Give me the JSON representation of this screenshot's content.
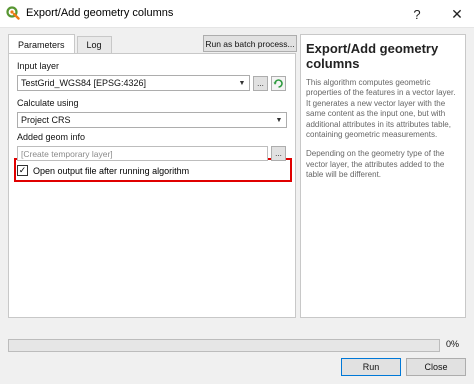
{
  "window": {
    "title": "Export/Add geometry columns",
    "help_glyph": "?",
    "close_glyph": "✕"
  },
  "tabs": [
    {
      "label": "Parameters",
      "active": true
    },
    {
      "label": "Log",
      "active": false
    }
  ],
  "batch_button": "Run as batch process...",
  "params": {
    "input_layer": {
      "label": "Input layer",
      "value": "TestGrid_WGS84 [EPSG:4326]",
      "browse_label": "..."
    },
    "calculate_using": {
      "label": "Calculate using",
      "value": "Project CRS"
    },
    "added_geom_info": {
      "label": "Added geom info",
      "placeholder": "[Create temporary layer]",
      "browse_label": "..."
    },
    "open_output": {
      "label": "Open output file after running algorithm",
      "checked": true,
      "check_glyph": "✓"
    }
  },
  "help": {
    "title": "Export/Add geometry columns",
    "paragraphs": [
      "This algorithm computes geometric properties of the features in a vector layer. It generates a new vector layer with the same content as the input one, but with additional attributes in its attributes table, containing geometric measurements.",
      "Depending on the geometry type of the vector layer, the attributes added to the table will be different."
    ]
  },
  "progress": {
    "value": 0,
    "label": "0%"
  },
  "buttons": {
    "run": "Run",
    "close": "Close"
  },
  "colors": {
    "highlight": "#e00000",
    "default_button_border": "#0078d7",
    "iterate_icon": "#2e9a3f"
  }
}
